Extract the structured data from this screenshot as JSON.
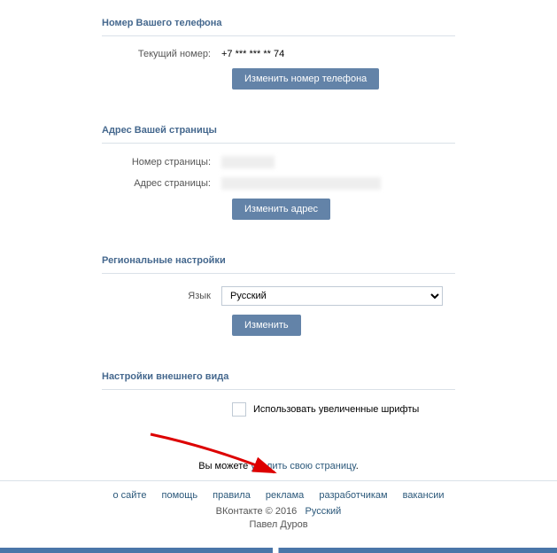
{
  "phone": {
    "title": "Номер Вашего телефона",
    "current_label": "Текущий номер:",
    "current_value": "+7 *** *** ** 74",
    "change_btn": "Изменить номер телефона"
  },
  "address": {
    "title": "Адрес Вашей страницы",
    "page_number_label": "Номер страницы:",
    "page_address_label": "Адрес страницы:",
    "change_btn": "Изменить адрес"
  },
  "regional": {
    "title": "Региональные настройки",
    "language_label": "Язык",
    "language_value": "Русский",
    "change_btn": "Изменить"
  },
  "appearance": {
    "title": "Настройки внешнего вида",
    "large_fonts_label": "Использовать увеличенные шрифты"
  },
  "delete": {
    "prefix": "Вы можете ",
    "link": "удалить свою страницу",
    "suffix": "."
  },
  "footer": {
    "links": [
      "о сайте",
      "помощь",
      "правила",
      "реклама",
      "разработчикам",
      "вакансии"
    ],
    "brand": "ВКонтакте",
    "copyright": "© 2016",
    "lang": "Русский",
    "author": "Павел Дуров"
  }
}
